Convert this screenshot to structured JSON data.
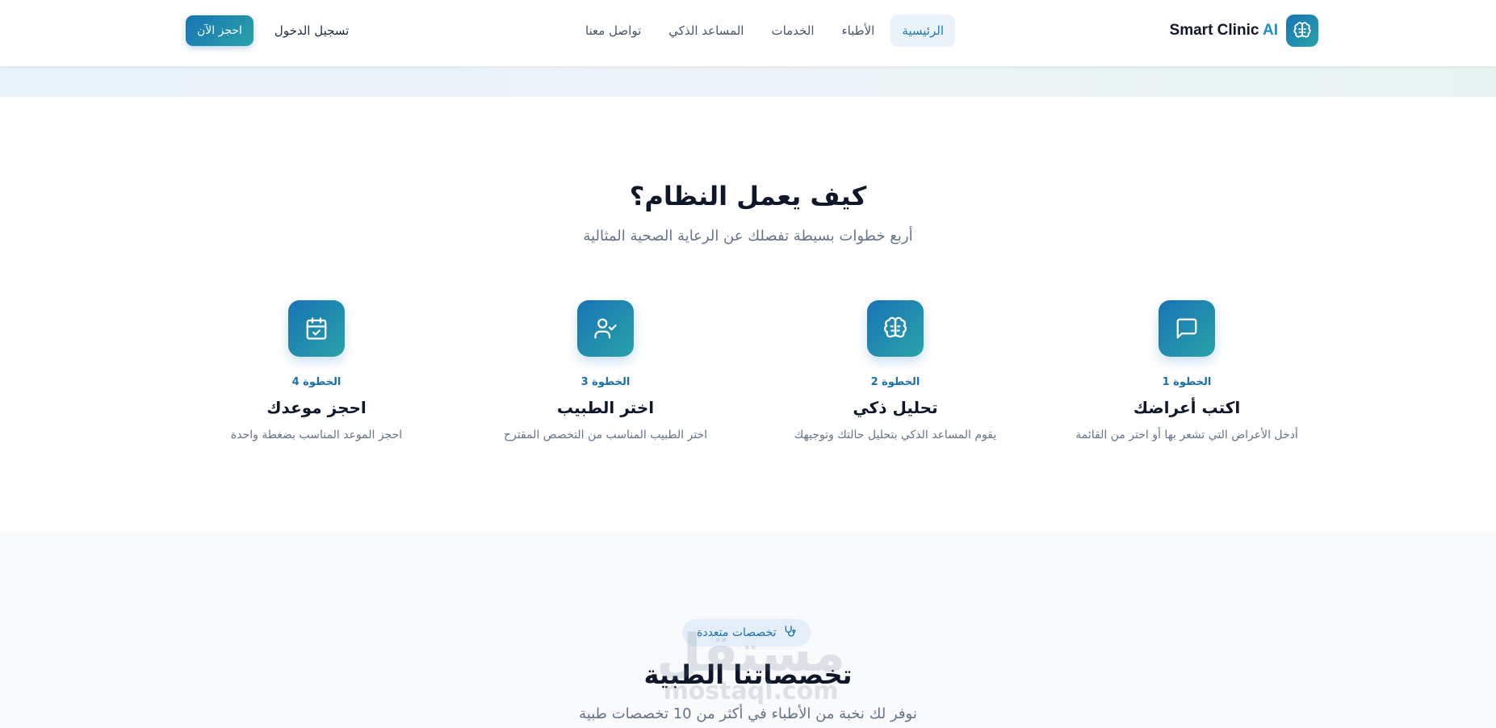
{
  "header": {
    "brand": {
      "name": "Smart Clinic",
      "accent": "AI",
      "logo_icon": "brain-icon"
    },
    "nav": [
      {
        "label": "الرئيسية",
        "active": true
      },
      {
        "label": "الأطباء",
        "active": false
      },
      {
        "label": "الخدمات",
        "active": false
      },
      {
        "label": "المساعد الذكي",
        "active": false
      },
      {
        "label": "تواصل معنا",
        "active": false
      }
    ],
    "login_label": "تسجيل الدخول",
    "book_label": "احجز الآن"
  },
  "how_it_works": {
    "title": "كيف يعمل النظام؟",
    "subtitle": "أربع خطوات بسيطة تفصلك عن الرعاية الصحية المثالية",
    "steps": [
      {
        "label": "الخطوة 1",
        "title": "اكتب أعراضك",
        "description": "أدخل الأعراض التي تشعر بها أو اختر من القائمة",
        "icon": "message-square-icon"
      },
      {
        "label": "الخطوة 2",
        "title": "تحليل ذكي",
        "description": "يقوم المساعد الذكي بتحليل حالتك وتوجيهك",
        "icon": "brain-icon"
      },
      {
        "label": "الخطوة 3",
        "title": "اختر الطبيب",
        "description": "اختر الطبيب المناسب من التخصص المقترح",
        "icon": "user-check-icon"
      },
      {
        "label": "الخطوة 4",
        "title": "احجز موعدك",
        "description": "احجز الموعد المناسب بضغطة واحدة",
        "icon": "calendar-check-icon"
      }
    ]
  },
  "specialties": {
    "badge_label": "تخصصات متعددة",
    "badge_icon": "stethoscope-icon",
    "title": "تخصصاتنا الطبية",
    "subtitle": "نوفر لك نخبة من الأطباء في أكثر من 10 تخصصات طبية"
  },
  "watermark": {
    "text": "مستقل",
    "domain": "mostaql.com"
  },
  "colors": {
    "primary": "#1873b5",
    "primary_alt": "#2aa3a8",
    "accent_text": "#1a6fae",
    "heading": "#0f172a",
    "muted": "#64748b"
  }
}
